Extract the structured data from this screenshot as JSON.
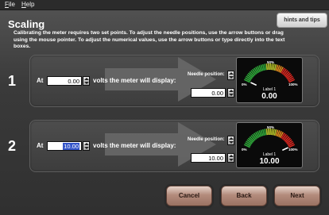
{
  "menu": {
    "file": "File",
    "help": "Help"
  },
  "title": "Scaling",
  "hints_button": "hints and tips",
  "instructions": "Calibrating the meter requires two set points. To adjust the needle positions, use the arrow buttons or drag using the mouse pointer. To adjust the numerical values, use the arrow buttons or type directly into the text boxes.",
  "rows": [
    {
      "number": "1",
      "at_label": "At",
      "volts_value": "0.00",
      "display_label": "volts the meter will display:",
      "needle_label": "Needle position:",
      "display_value": "0.00",
      "meter": {
        "min": "0%",
        "mid": "50%",
        "max": "100%",
        "label": "Label 1",
        "reading": "0.00",
        "needle_fraction": 0.0
      }
    },
    {
      "number": "2",
      "at_label": "At",
      "volts_value": "10.00",
      "display_label": "volts the meter will display:",
      "needle_label": "Needle position:",
      "display_value": "10.00",
      "meter": {
        "min": "0%",
        "mid": "50%",
        "max": "100%",
        "label": "Label 1",
        "reading": "10.00",
        "needle_fraction": 1.0
      }
    }
  ],
  "buttons": {
    "cancel": "Cancel",
    "back": "Back",
    "next": "Next"
  },
  "colors": {
    "accent_red": "#d8261f",
    "accent_green": "#2fa83a",
    "button": "#b38b7c"
  }
}
